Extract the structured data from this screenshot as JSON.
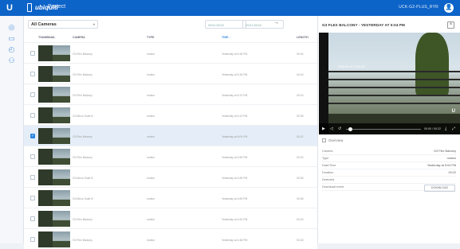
{
  "topbar": {
    "logo": "U",
    "brand": "ubiquiti",
    "product": "Protect",
    "host": "UCK-G2-PLUS_RYR",
    "avatar": "👤"
  },
  "sidebar": {
    "icons": [
      "dashboard-icon",
      "camera-icon",
      "clock-icon",
      "user-icon"
    ]
  },
  "filters": {
    "camera_select": "All Cameras",
    "date_from": "09/11/2018",
    "date_to": "09/11/2018",
    "arrow": "→"
  },
  "table": {
    "headers": {
      "thumbnail": "THUMBNAIL",
      "camera": "CAMERA",
      "type": "TYPE",
      "time": "TIME ↓",
      "length": "LENGTH"
    },
    "rows": [
      {
        "camera": "G3 Flex Balcony",
        "type": "motion",
        "time": "Yesterday at 5:18 PM",
        "length": "00:44",
        "selected": false
      },
      {
        "camera": "G3 Flex Balcony",
        "type": "motion",
        "time": "Yesterday at 5:18 PM",
        "length": "00:16",
        "selected": false
      },
      {
        "camera": "G3 Flex Balcony",
        "type": "motion",
        "time": "Yesterday at 5:13 PM",
        "length": "00:16",
        "selected": false
      },
      {
        "camera": "G3 Micro Suite B",
        "type": "motion",
        "time": "Yesterday at 5:13 PM",
        "length": "00:08",
        "selected": false
      },
      {
        "camera": "G3 Flex Balcony",
        "type": "motion",
        "time": "Yesterday at 5:04 PM",
        "length": "00:22",
        "selected": true
      },
      {
        "camera": "G3 Flex Balcony",
        "type": "motion",
        "time": "Yesterday at 4:59 PM",
        "length": "00:20",
        "selected": false
      },
      {
        "camera": "G3 Micro Suite B",
        "type": "motion",
        "time": "Yesterday at 4:59 PM",
        "length": "00:06",
        "selected": false
      },
      {
        "camera": "G3 Micro Suite B",
        "type": "motion",
        "time": "Yesterday at 4:59 PM",
        "length": "00:08",
        "selected": false
      },
      {
        "camera": "G3 Flex Balcony",
        "type": "motion",
        "time": "Yesterday at 4:52 PM",
        "length": "00:16",
        "selected": false
      },
      {
        "camera": "G3 Flex Balcony",
        "type": "motion",
        "time": "Yesterday at 4:48 PM",
        "length": "00:18",
        "selected": false
      }
    ]
  },
  "panel": {
    "title": "G3 FLEX BALCONY - YESTERDAY AT 5:04 PM",
    "close": "×",
    "video_timestamp": "2018-09-10 17:04:48",
    "video_logo": "U",
    "current_time": "00:00 / 00:22",
    "overview_label": "Overview",
    "fields": [
      {
        "key": "Camera",
        "value": "G3 Flex Balcony"
      },
      {
        "key": "Type",
        "value": "motion"
      },
      {
        "key": "Date/Time",
        "value": "Yesterday at 5:04 PM"
      },
      {
        "key": "Duration",
        "value": "00:22"
      },
      {
        "key": "Detected",
        "value": ""
      },
      {
        "key": "Download event",
        "value": ""
      }
    ],
    "download_button": "DOWNLOAD"
  }
}
